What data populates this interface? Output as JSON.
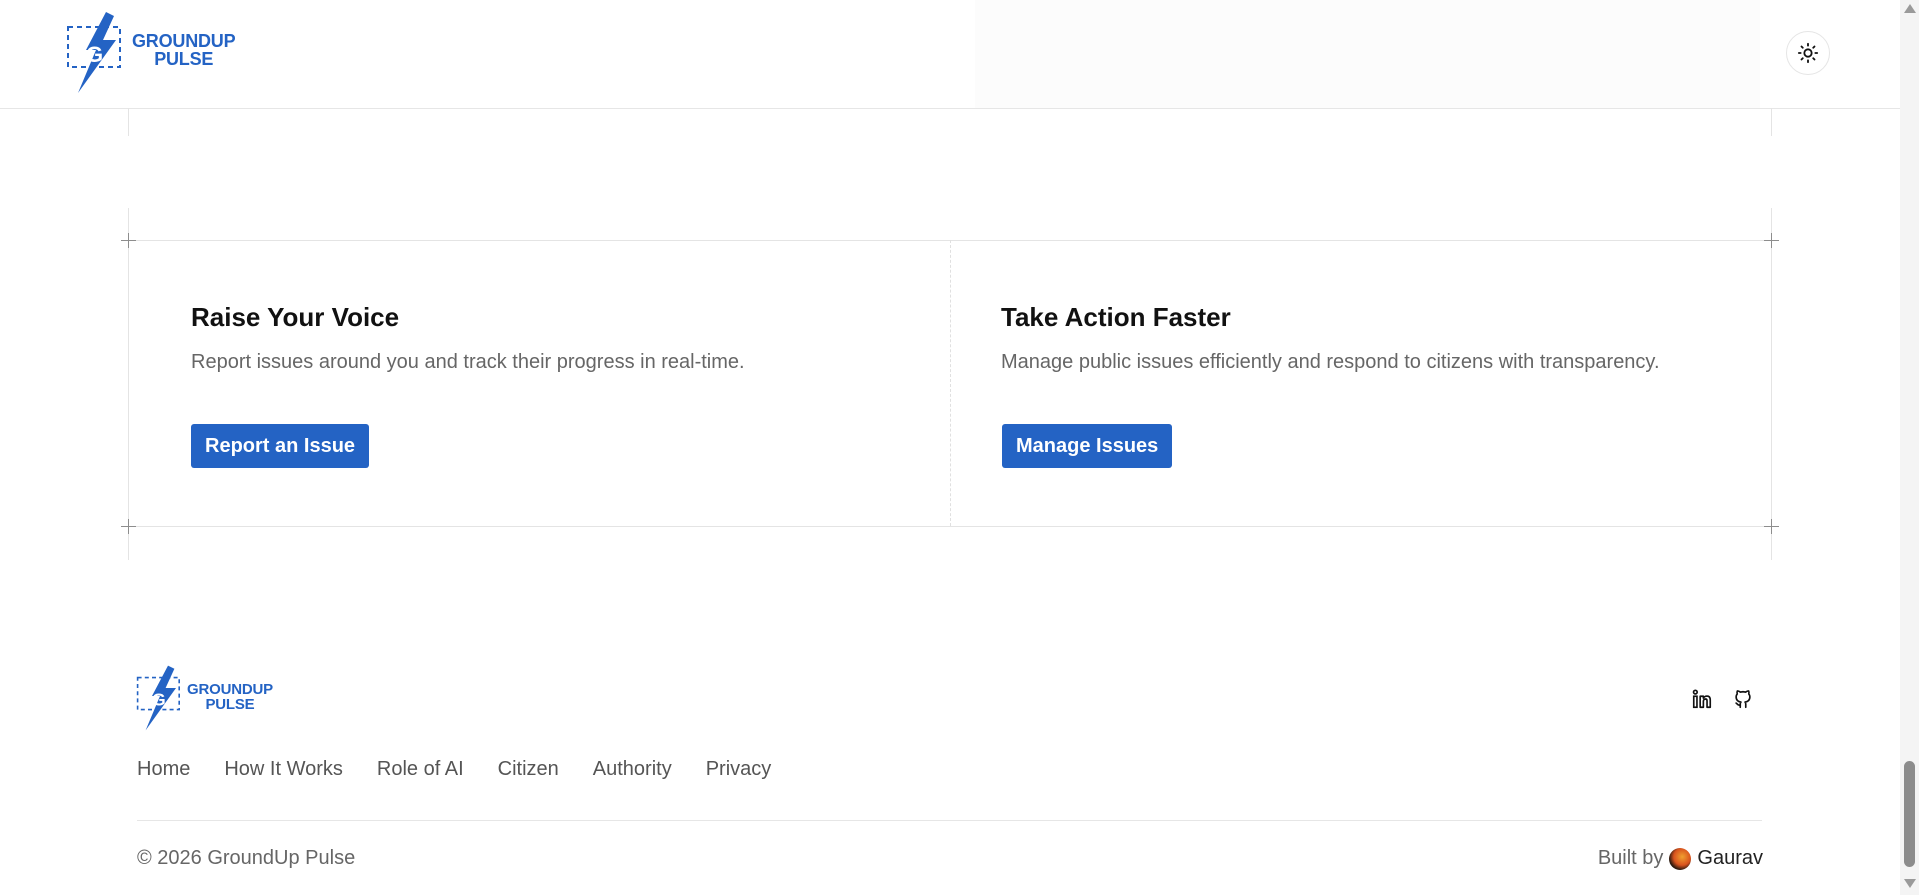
{
  "header": {
    "logo": {
      "line1": "GROUNDUP",
      "line2": "PULSE",
      "badge_letter": "G"
    },
    "theme_toggle_icon": "sun-icon"
  },
  "cards": {
    "citizen": {
      "title": "Raise Your Voice",
      "description": "Report issues around you and track their progress in real-time.",
      "button": "Report an Issue"
    },
    "authority": {
      "title": "Take Action Faster",
      "description": "Manage public issues efficiently and respond to citizens with transparency.",
      "button": "Manage Issues"
    }
  },
  "footer": {
    "logo": {
      "line1": "GROUNDUP",
      "line2": "PULSE",
      "badge_letter": "G"
    },
    "nav": [
      "Home",
      "How It Works",
      "Role of AI",
      "Citizen",
      "Authority",
      "Privacy"
    ],
    "social_icons": [
      "linkedin-icon",
      "github-icon"
    ],
    "copyright": "© 2026 GroundUp Pulse",
    "built_by_label": "Built by",
    "author": "Gaurav"
  },
  "colors": {
    "brand_blue": "#2463c4",
    "text_muted": "#666666",
    "grid_line": "#e4e4e4"
  }
}
